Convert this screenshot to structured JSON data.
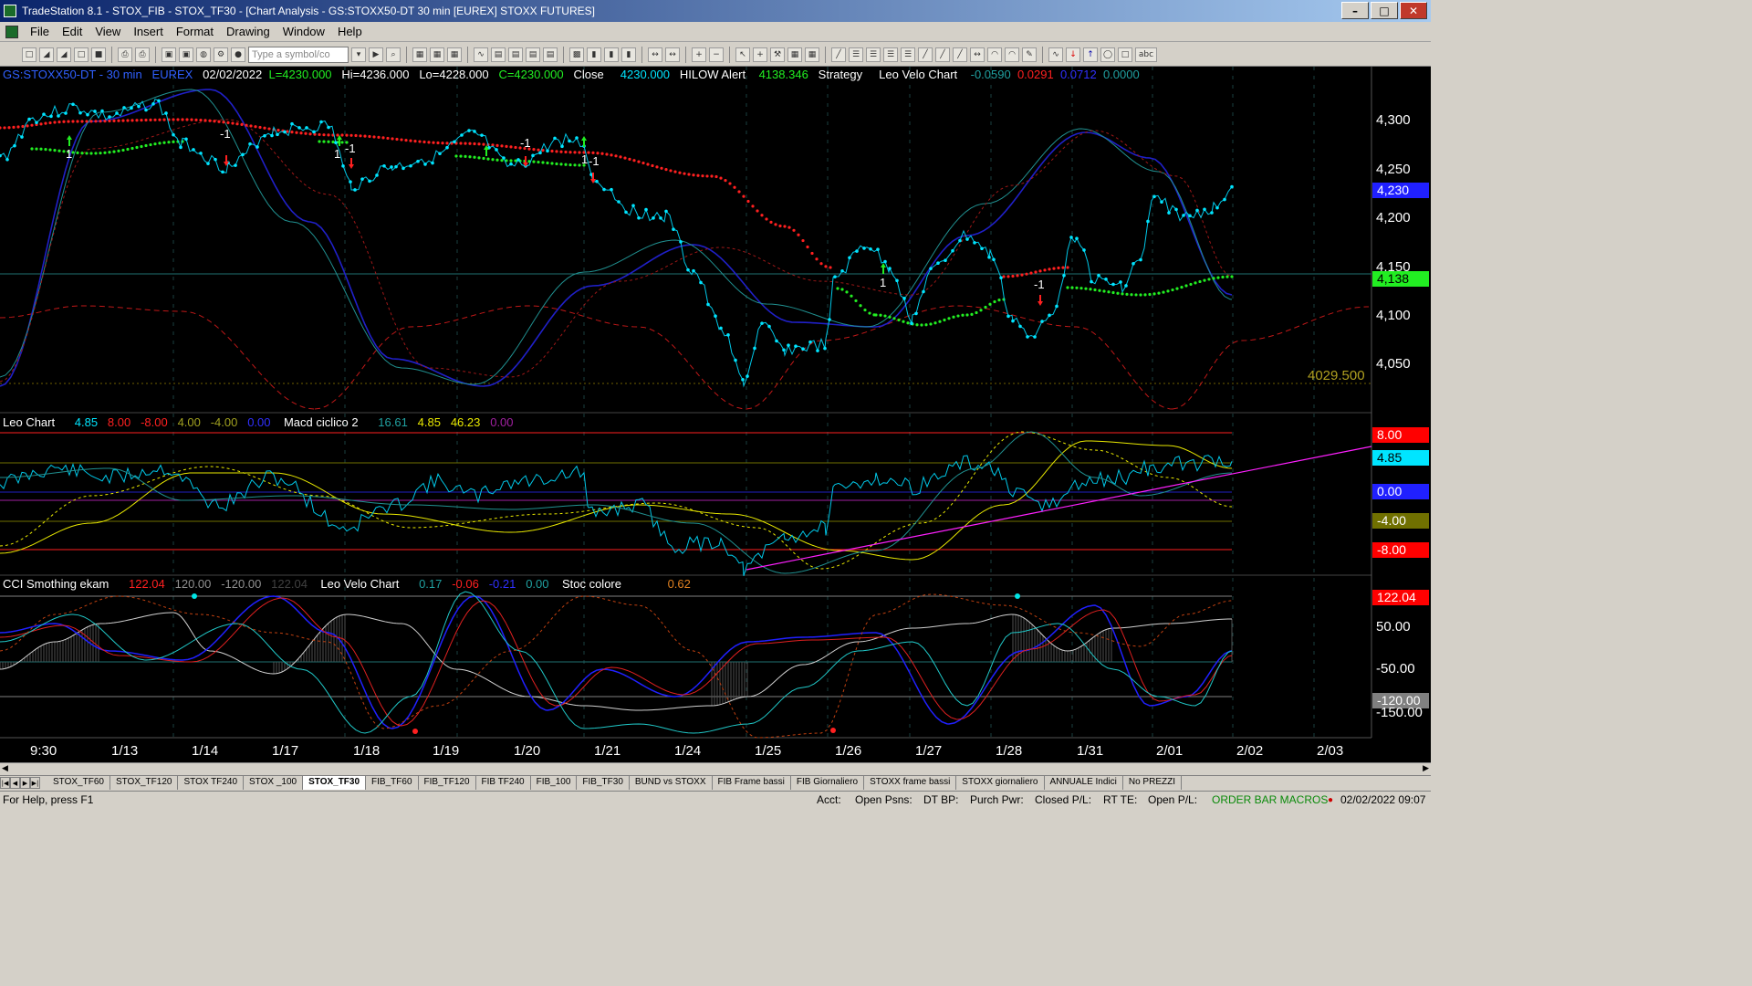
{
  "window": {
    "title": "TradeStation 8.1 - STOX_FIB - STOX_TF30 - [Chart Analysis - GS:STOXX50-DT  30 min  [EUREX] STOXX FUTURES]"
  },
  "menu": [
    "File",
    "Edit",
    "View",
    "Insert",
    "Format",
    "Drawing",
    "Window",
    "Help"
  ],
  "toolbar": {
    "symbol_placeholder": "Type a symbol/co",
    "abc": "abc"
  },
  "price_header": {
    "symbol": "GS:STOXX50-DT - 30 min",
    "exchange": "EUREX",
    "date": "02/02/2022",
    "last": "L=4230.000",
    "hi": "Hi=4236.000",
    "lo": "Lo=4228.000",
    "close_val": "C=4230.000",
    "close_label": "Close",
    "close_price": "4230.000",
    "hilow_label": "HILOW Alert",
    "hilow_val": "4138.346",
    "strategy": "Strategy",
    "leovelo": "Leo Velo Chart",
    "v1": "-0.0590",
    "v2": "0.0291",
    "v3": "0.0712",
    "v4": "0.0000"
  },
  "osc1_header": {
    "name": "Leo Chart",
    "v1": "4.85",
    "v2": "8.00",
    "v3": "-8.00",
    "v4": "4.00",
    "v5": "-4.00",
    "v6": "0.00",
    "name2": "Macd ciclico 2",
    "m1": "16.61",
    "m2": "4.85",
    "m3": "46.23",
    "m4": "0.00"
  },
  "osc2_header": {
    "name": "CCI Smothing ekam",
    "c1": "122.04",
    "c2": "120.00",
    "c3": "-120.00",
    "c4": "122.04",
    "name2": "Leo Velo Chart",
    "l1": "0.17",
    "l2": "-0.06",
    "l3": "-0.21",
    "l4": "0.00",
    "name3": "Stoc colore",
    "s1": "0.62"
  },
  "price_axis": {
    "ticks": [
      "4,300",
      "4,250",
      "4,200",
      "4,150",
      "4,100",
      "4,050"
    ],
    "last_box": "4,230",
    "hilow_box": "4,138",
    "level_label": "4029.500"
  },
  "osc1_axis": {
    "b8": "8.00",
    "b485": "4.85",
    "b0": "0.00",
    "bm4": "-4.00",
    "bm8": "-8.00"
  },
  "osc2_axis": {
    "b122": "122.04",
    "b50": "50.00",
    "bm50": "-50.00",
    "bm120": "-120.00",
    "bm150": "-150.00"
  },
  "date_axis": [
    "9:30",
    "1/13",
    "1/14",
    "1/17",
    "1/18",
    "1/19",
    "1/20",
    "1/21",
    "1/24",
    "1/25",
    "1/26",
    "1/27",
    "1/28",
    "1/31",
    "2/01",
    "2/02",
    "2/03"
  ],
  "signals": {
    "buy": "1",
    "sell": "-1"
  },
  "sheet_tabs": [
    "STOX_TF60",
    "STOX_TF120",
    "STOX TF240",
    "STOX _100",
    "STOX_TF30",
    "FIB_TF60",
    "FIB_TF120",
    "FIB TF240",
    "FIB_100",
    "FIB_TF30",
    "BUND vs STOXX",
    "FIB Frame bassi",
    "FIB Giornaliero",
    "STOXX frame bassi",
    "STOXX giornaliero",
    "ANNUALE Indici",
    "No PREZZI"
  ],
  "active_tab": "STOX_TF30",
  "status": {
    "help": "For Help, press F1",
    "acct": "Acct:",
    "open_psns": "Open Psns:",
    "dt_bp": "DT BP:",
    "purch_pwr": "Purch Pwr:",
    "closed_pl": "Closed P/L:",
    "rt_te": "RT TE:",
    "open_pl": "Open P/L:",
    "macros": "ORDER BAR  MACROS",
    "datetime": "02/02/2022 09:07"
  },
  "colors": {
    "bg": "#000000",
    "price_line": "#00e5ff",
    "hilow_red": "#ff2020",
    "hilow_green": "#22ee22",
    "macd_yellow": "#e8e800",
    "magenta": "#ff20ff",
    "blue": "#2020ff",
    "teal": "#20a0a0"
  }
}
